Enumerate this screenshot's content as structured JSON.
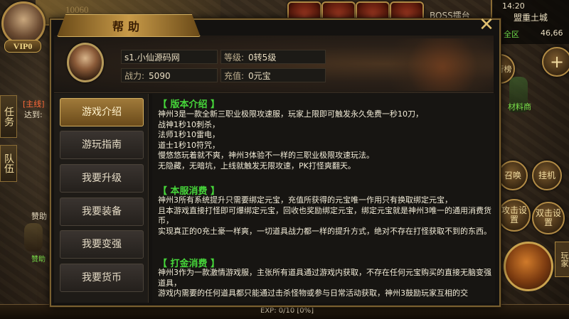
{
  "hud": {
    "vip": "VIP0",
    "power_faded": "10060",
    "boss_label": "BOSS擂台",
    "time": "14:20",
    "city": "盟重土城",
    "zone": "全区",
    "coords": "46,66",
    "plus": "+",
    "rank_label": "排行榜",
    "summon_label": "召唤",
    "hangup_label": "挂机",
    "atk1_label": "攻击设置",
    "atk2_label": "双击设置",
    "mall_label": "玩家",
    "npc_label": "材料商",
    "task_tab": "任务",
    "team_tab": "队伍",
    "quest_main": "[主线]",
    "quest_reach": "达到:",
    "assist": "赞助",
    "assist2": "赞助",
    "exp": "EXP: 0/10 [0%]"
  },
  "dialog": {
    "title": "帮助",
    "close": "✕",
    "player": {
      "name": "s1.小仙源码网",
      "level_label": "等级:",
      "level": "0转5级",
      "power_label": "战力:",
      "power": "5090",
      "recharge_label": "充值:",
      "recharge": "0元宝"
    },
    "menu": [
      {
        "label": "游戏介绍",
        "active": true
      },
      {
        "label": "游玩指南",
        "active": false
      },
      {
        "label": "我要升级",
        "active": false
      },
      {
        "label": "我要装备",
        "active": false
      },
      {
        "label": "我要变强",
        "active": false
      },
      {
        "label": "我要货币",
        "active": false
      }
    ],
    "sections": [
      {
        "title": "【 版本介绍 】",
        "text": "神州3是一款全新三职业极限攻速服，玩家上限即可触发永久免费一秒10刀，\n战神1秒10刺杀，\n法师1秒10雷电，\n道士1秒10符咒，\n慢悠悠玩着就不爽，神州3体验不一样的三职业极限攻速玩法。\n无隐藏，无暗坑，上线就触发无限攻速，PK打怪爽翻天。"
      },
      {
        "title": "【 本服消费 】",
        "text": "神州3所有系统提升只需要绑定元宝，充值所获得的元宝唯一作用只有换取绑定元宝，\n且本游戏直接打怪即可爆绑定元宝，回收也奖励绑定元宝，绑定元宝就是神州3唯一的通用消费货币，\n实现真正的0充土豪一样爽，一切道具战力都一样的提升方式，绝对不存在打怪获取不到的东西。"
      },
      {
        "title": "【 打金消费 】",
        "text": "神州3作为一款激情游戏服，主张所有道具通过游戏内获取，不存在任何元宝购买的直接无脑变强道具，\n游戏内需要的任何道具都只能通过击杀怪物或参与日常活动获取，神州3鼓励玩家互相的交"
      }
    ]
  }
}
